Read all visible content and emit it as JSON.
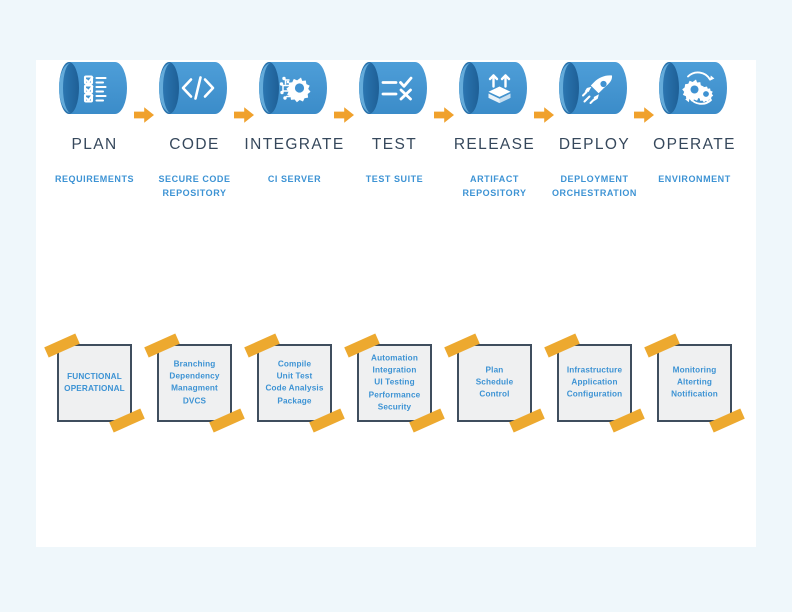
{
  "theme": {
    "page_background": "#eff7fb",
    "panel_background": "#ffffff",
    "accent_blue": "#3d93d4",
    "cylinder_blue": "#3f92d2",
    "cylinder_dark": "#1d6ba8",
    "arrow_orange": "#f0a12c",
    "tape_orange": "#eda92f",
    "title_color": "#36485c",
    "note_border": "#3f4e5e",
    "note_fill": "#eff0f1"
  },
  "pipeline": {
    "stages": [
      {
        "id": "plan",
        "title": "PLAN",
        "subtitle": "REQUIREMENTS",
        "icon": "checklist-icon",
        "note": [
          "FUNCTIONAL",
          "OPERATIONAL"
        ]
      },
      {
        "id": "code",
        "title": "CODE",
        "subtitle": "SECURE CODE\nREPOSITORY",
        "icon": "code-brackets-icon",
        "note": [
          "Branching",
          "Dependency",
          "Managment",
          "DVCS"
        ]
      },
      {
        "id": "integrate",
        "title": "INTEGRATE",
        "subtitle": "CI SERVER",
        "icon": "gear-circuit-icon",
        "note": [
          "Compile",
          "Unit Test",
          "Code Analysis",
          "Package"
        ]
      },
      {
        "id": "test",
        "title": "TEST",
        "subtitle": "TEST SUITE",
        "icon": "check-cross-list-icon",
        "note": [
          "Automation",
          "Integration",
          "UI Testing",
          "Performance",
          "Security"
        ]
      },
      {
        "id": "release",
        "title": "RELEASE",
        "subtitle": "ARTIFACT\nREPOSITORY",
        "icon": "package-upload-icon",
        "note": [
          "Plan",
          "Schedule",
          "Control"
        ]
      },
      {
        "id": "deploy",
        "title": "DEPLOY",
        "subtitle": "DEPLOYMENT\nORCHESTRATION",
        "icon": "rocket-icon",
        "note": [
          "Infrastructure",
          "Application",
          "Configuration"
        ]
      },
      {
        "id": "operate",
        "title": "OPERATE",
        "subtitle": "ENVIRONMENT",
        "icon": "gears-refresh-icon",
        "note": [
          "Monitoring",
          "Alterting",
          "Notification"
        ]
      }
    ],
    "connectors": [
      {
        "id": "arrow-plan-code",
        "icon": "arrow-right-icon"
      },
      {
        "id": "arrow-code-integrate",
        "icon": "arrow-right-icon"
      },
      {
        "id": "arrow-integrate-test",
        "icon": "arrow-right-icon"
      },
      {
        "id": "arrow-test-release",
        "icon": "arrow-right-icon"
      },
      {
        "id": "arrow-release-deploy",
        "icon": "arrow-right-icon"
      },
      {
        "id": "arrow-deploy-operate",
        "icon": "arrow-right-icon"
      }
    ]
  }
}
